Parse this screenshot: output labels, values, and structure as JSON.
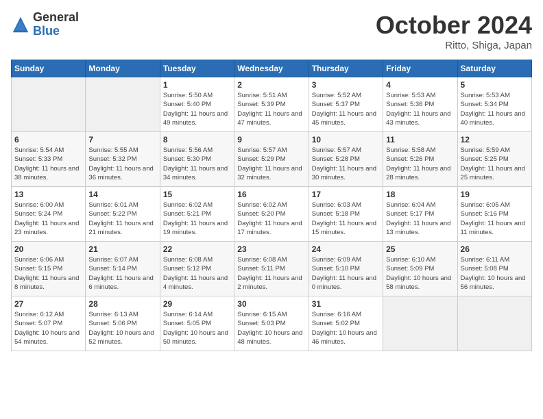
{
  "logo": {
    "general": "General",
    "blue": "Blue"
  },
  "header": {
    "month": "October 2024",
    "location": "Ritto, Shiga, Japan"
  },
  "weekdays": [
    "Sunday",
    "Monday",
    "Tuesday",
    "Wednesday",
    "Thursday",
    "Friday",
    "Saturday"
  ],
  "weeks": [
    [
      null,
      null,
      {
        "day": "1",
        "sunrise": "Sunrise: 5:50 AM",
        "sunset": "Sunset: 5:40 PM",
        "daylight": "Daylight: 11 hours and 49 minutes."
      },
      {
        "day": "2",
        "sunrise": "Sunrise: 5:51 AM",
        "sunset": "Sunset: 5:39 PM",
        "daylight": "Daylight: 11 hours and 47 minutes."
      },
      {
        "day": "3",
        "sunrise": "Sunrise: 5:52 AM",
        "sunset": "Sunset: 5:37 PM",
        "daylight": "Daylight: 11 hours and 45 minutes."
      },
      {
        "day": "4",
        "sunrise": "Sunrise: 5:53 AM",
        "sunset": "Sunset: 5:36 PM",
        "daylight": "Daylight: 11 hours and 43 minutes."
      },
      {
        "day": "5",
        "sunrise": "Sunrise: 5:53 AM",
        "sunset": "Sunset: 5:34 PM",
        "daylight": "Daylight: 11 hours and 40 minutes."
      }
    ],
    [
      {
        "day": "6",
        "sunrise": "Sunrise: 5:54 AM",
        "sunset": "Sunset: 5:33 PM",
        "daylight": "Daylight: 11 hours and 38 minutes."
      },
      {
        "day": "7",
        "sunrise": "Sunrise: 5:55 AM",
        "sunset": "Sunset: 5:32 PM",
        "daylight": "Daylight: 11 hours and 36 minutes."
      },
      {
        "day": "8",
        "sunrise": "Sunrise: 5:56 AM",
        "sunset": "Sunset: 5:30 PM",
        "daylight": "Daylight: 11 hours and 34 minutes."
      },
      {
        "day": "9",
        "sunrise": "Sunrise: 5:57 AM",
        "sunset": "Sunset: 5:29 PM",
        "daylight": "Daylight: 11 hours and 32 minutes."
      },
      {
        "day": "10",
        "sunrise": "Sunrise: 5:57 AM",
        "sunset": "Sunset: 5:28 PM",
        "daylight": "Daylight: 11 hours and 30 minutes."
      },
      {
        "day": "11",
        "sunrise": "Sunrise: 5:58 AM",
        "sunset": "Sunset: 5:26 PM",
        "daylight": "Daylight: 11 hours and 28 minutes."
      },
      {
        "day": "12",
        "sunrise": "Sunrise: 5:59 AM",
        "sunset": "Sunset: 5:25 PM",
        "daylight": "Daylight: 11 hours and 25 minutes."
      }
    ],
    [
      {
        "day": "13",
        "sunrise": "Sunrise: 6:00 AM",
        "sunset": "Sunset: 5:24 PM",
        "daylight": "Daylight: 11 hours and 23 minutes."
      },
      {
        "day": "14",
        "sunrise": "Sunrise: 6:01 AM",
        "sunset": "Sunset: 5:22 PM",
        "daylight": "Daylight: 11 hours and 21 minutes."
      },
      {
        "day": "15",
        "sunrise": "Sunrise: 6:02 AM",
        "sunset": "Sunset: 5:21 PM",
        "daylight": "Daylight: 11 hours and 19 minutes."
      },
      {
        "day": "16",
        "sunrise": "Sunrise: 6:02 AM",
        "sunset": "Sunset: 5:20 PM",
        "daylight": "Daylight: 11 hours and 17 minutes."
      },
      {
        "day": "17",
        "sunrise": "Sunrise: 6:03 AM",
        "sunset": "Sunset: 5:18 PM",
        "daylight": "Daylight: 11 hours and 15 minutes."
      },
      {
        "day": "18",
        "sunrise": "Sunrise: 6:04 AM",
        "sunset": "Sunset: 5:17 PM",
        "daylight": "Daylight: 11 hours and 13 minutes."
      },
      {
        "day": "19",
        "sunrise": "Sunrise: 6:05 AM",
        "sunset": "Sunset: 5:16 PM",
        "daylight": "Daylight: 11 hours and 11 minutes."
      }
    ],
    [
      {
        "day": "20",
        "sunrise": "Sunrise: 6:06 AM",
        "sunset": "Sunset: 5:15 PM",
        "daylight": "Daylight: 11 hours and 8 minutes."
      },
      {
        "day": "21",
        "sunrise": "Sunrise: 6:07 AM",
        "sunset": "Sunset: 5:14 PM",
        "daylight": "Daylight: 11 hours and 6 minutes."
      },
      {
        "day": "22",
        "sunrise": "Sunrise: 6:08 AM",
        "sunset": "Sunset: 5:12 PM",
        "daylight": "Daylight: 11 hours and 4 minutes."
      },
      {
        "day": "23",
        "sunrise": "Sunrise: 6:08 AM",
        "sunset": "Sunset: 5:11 PM",
        "daylight": "Daylight: 11 hours and 2 minutes."
      },
      {
        "day": "24",
        "sunrise": "Sunrise: 6:09 AM",
        "sunset": "Sunset: 5:10 PM",
        "daylight": "Daylight: 11 hours and 0 minutes."
      },
      {
        "day": "25",
        "sunrise": "Sunrise: 6:10 AM",
        "sunset": "Sunset: 5:09 PM",
        "daylight": "Daylight: 10 hours and 58 minutes."
      },
      {
        "day": "26",
        "sunrise": "Sunrise: 6:11 AM",
        "sunset": "Sunset: 5:08 PM",
        "daylight": "Daylight: 10 hours and 56 minutes."
      }
    ],
    [
      {
        "day": "27",
        "sunrise": "Sunrise: 6:12 AM",
        "sunset": "Sunset: 5:07 PM",
        "daylight": "Daylight: 10 hours and 54 minutes."
      },
      {
        "day": "28",
        "sunrise": "Sunrise: 6:13 AM",
        "sunset": "Sunset: 5:06 PM",
        "daylight": "Daylight: 10 hours and 52 minutes."
      },
      {
        "day": "29",
        "sunrise": "Sunrise: 6:14 AM",
        "sunset": "Sunset: 5:05 PM",
        "daylight": "Daylight: 10 hours and 50 minutes."
      },
      {
        "day": "30",
        "sunrise": "Sunrise: 6:15 AM",
        "sunset": "Sunset: 5:03 PM",
        "daylight": "Daylight: 10 hours and 48 minutes."
      },
      {
        "day": "31",
        "sunrise": "Sunrise: 6:16 AM",
        "sunset": "Sunset: 5:02 PM",
        "daylight": "Daylight: 10 hours and 46 minutes."
      },
      null,
      null
    ]
  ]
}
